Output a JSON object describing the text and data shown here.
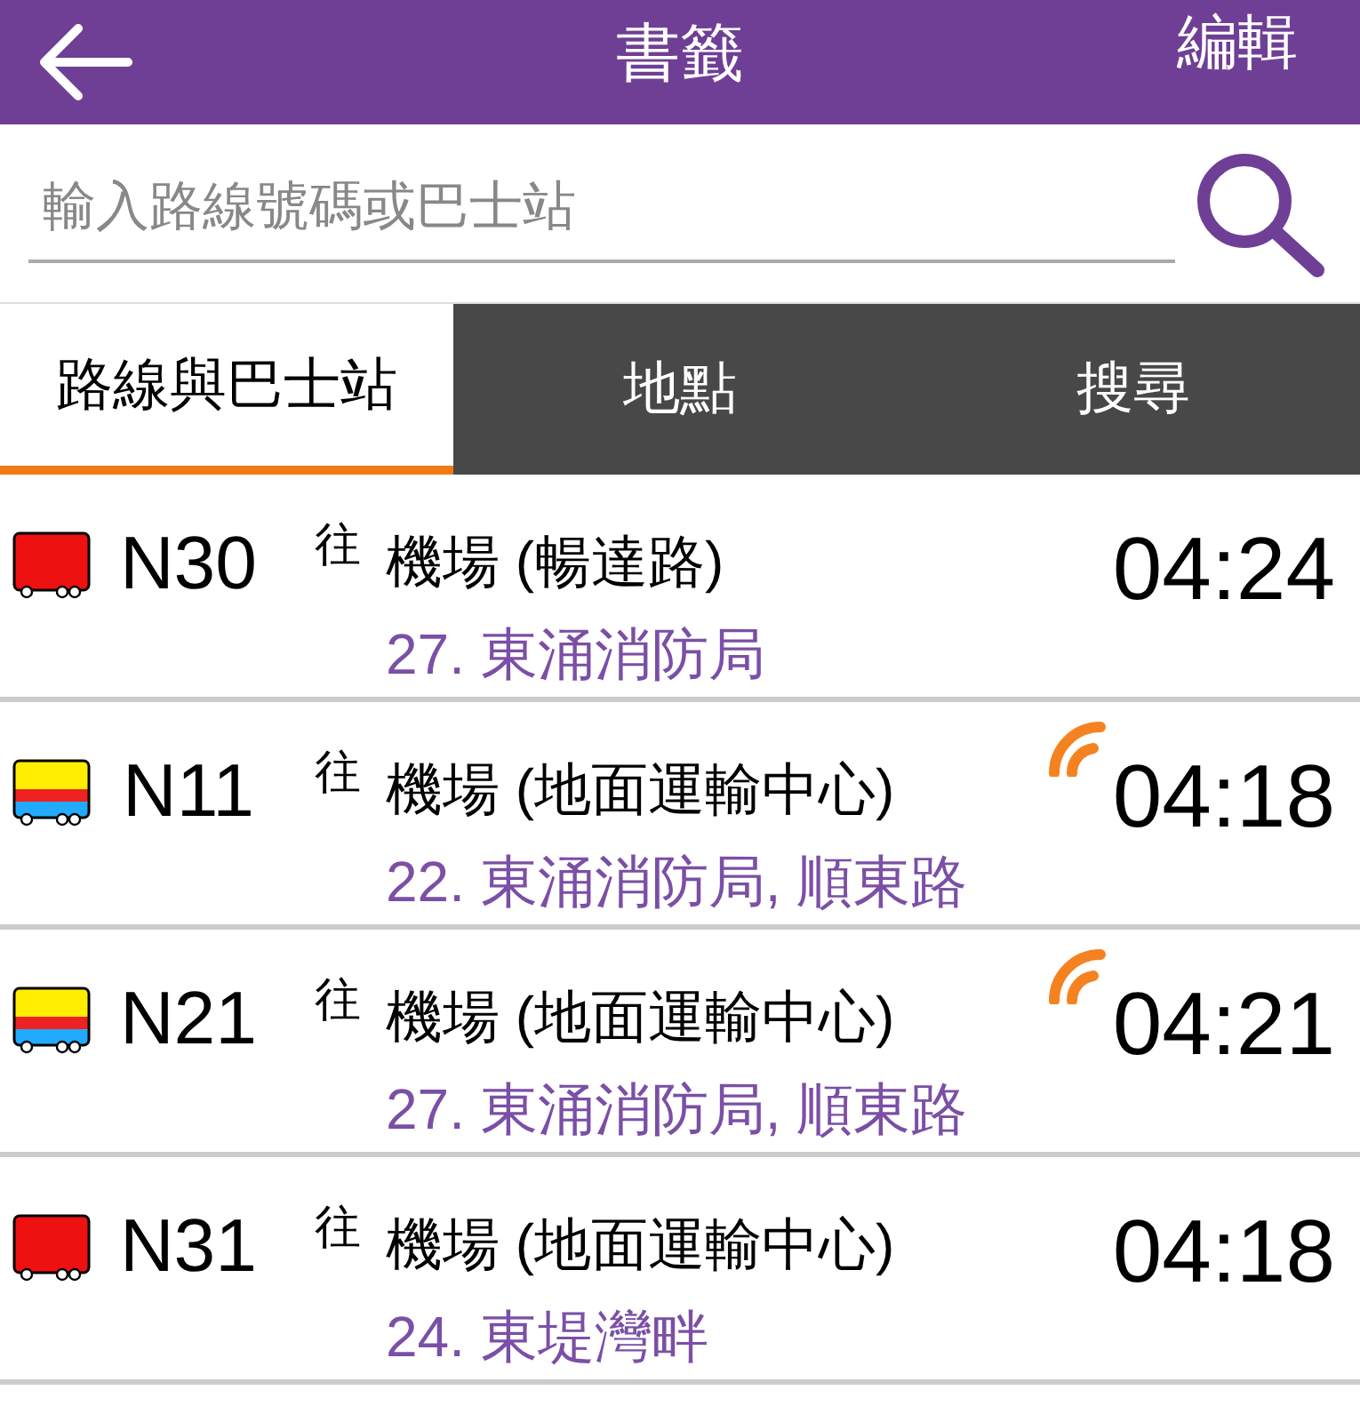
{
  "header": {
    "title": "書籤",
    "action": "編輯"
  },
  "search": {
    "placeholder": "輸入路線號碼或巴士站"
  },
  "tabs": [
    {
      "label": "路線與巴士站",
      "selected": true
    },
    {
      "label": "地點",
      "selected": false
    },
    {
      "label": "搜尋",
      "selected": false
    }
  ],
  "routes": [
    {
      "kind": "solid",
      "route": "N30",
      "towards": "往",
      "destination": "機場 (暢達路)",
      "stop": "27. 東涌消防局",
      "time": "04:24",
      "live": false
    },
    {
      "kind": "striped",
      "route": "N11",
      "towards": "往",
      "destination": "機場 (地面運輸中心)",
      "stop": "22. 東涌消防局, 順東路",
      "time": "04:18",
      "live": true
    },
    {
      "kind": "striped",
      "route": "N21",
      "towards": "往",
      "destination": "機場 (地面運輸中心)",
      "stop": "27. 東涌消防局, 順東路",
      "time": "04:21",
      "live": true
    },
    {
      "kind": "solid",
      "route": "N31",
      "towards": "往",
      "destination": "機場 (地面運輸中心)",
      "stop": "24. 東堤灣畔",
      "time": "04:18",
      "live": false
    }
  ]
}
